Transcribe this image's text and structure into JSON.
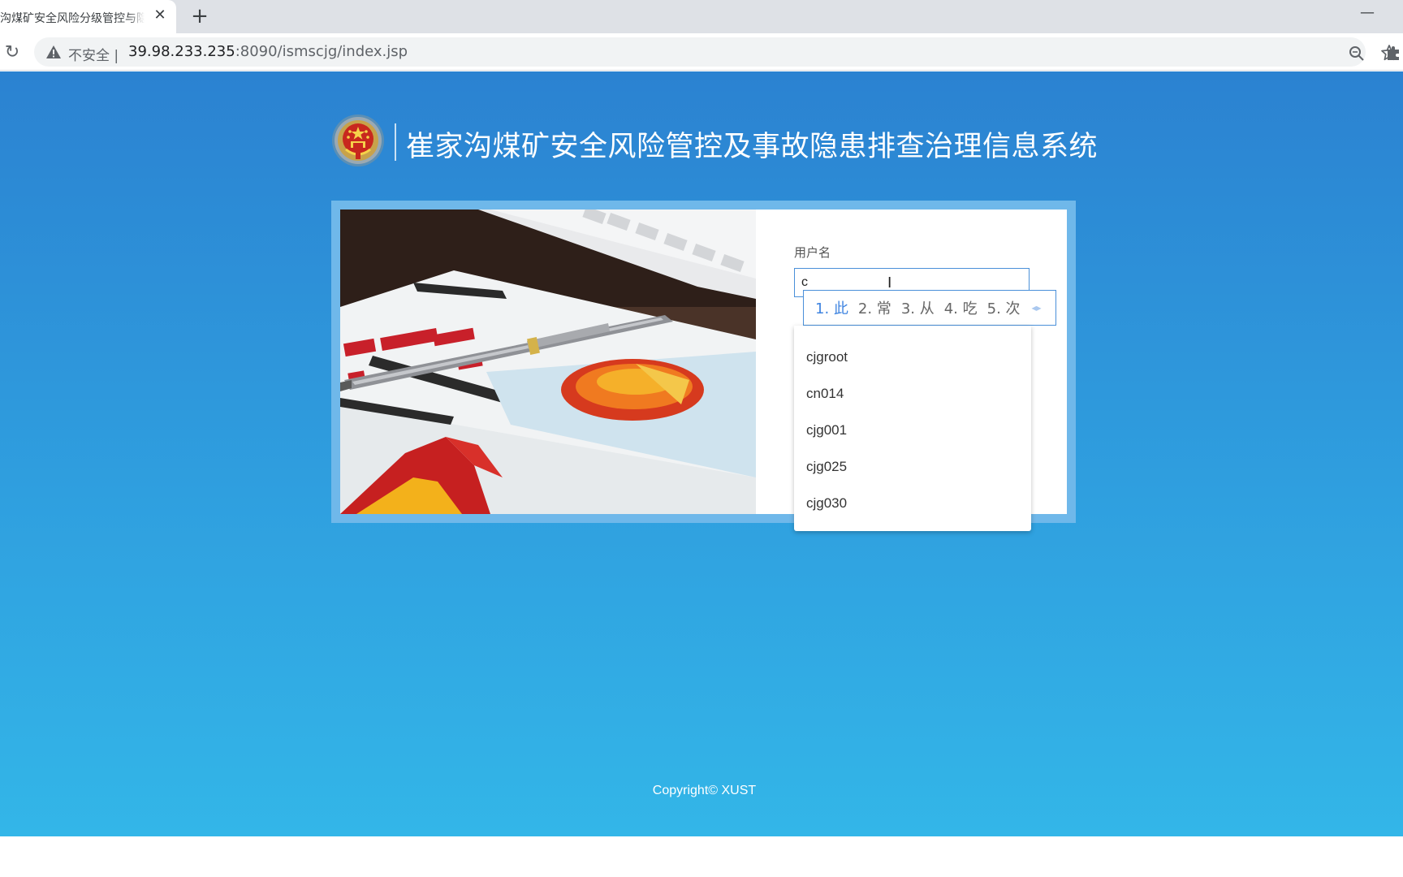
{
  "browser": {
    "tab_title": "沟煤矿安全风险分级管控与隐患排查",
    "tab_close": "✕",
    "new_tab": "+",
    "minimize": "—",
    "reload": "↻",
    "security_label": "不安全 |",
    "url_host": "39.98.233.235",
    "url_rest": ":8090/ismscjg/index.jsp"
  },
  "header": {
    "title": "崔家沟煤矿安全风险管控及事故隐患排查治理信息系统"
  },
  "login": {
    "username_label": "用户名",
    "username_value": "c"
  },
  "ime": {
    "candidates": [
      "1. 此",
      "2. 常",
      "3. 从",
      "4. 吃",
      "5. 次"
    ],
    "arrows": "◂▸"
  },
  "autocomplete": {
    "items": [
      "cjgroot",
      "cn014",
      "cjg001",
      "cjg025",
      "cjg030"
    ]
  },
  "footer": {
    "copyright": "Copyright© XUST"
  },
  "colors": {
    "page_top": "#2b82d1",
    "page_bottom": "#33b6e8",
    "card_frame": "#6fb8ea",
    "input_border": "#4a90d9"
  }
}
